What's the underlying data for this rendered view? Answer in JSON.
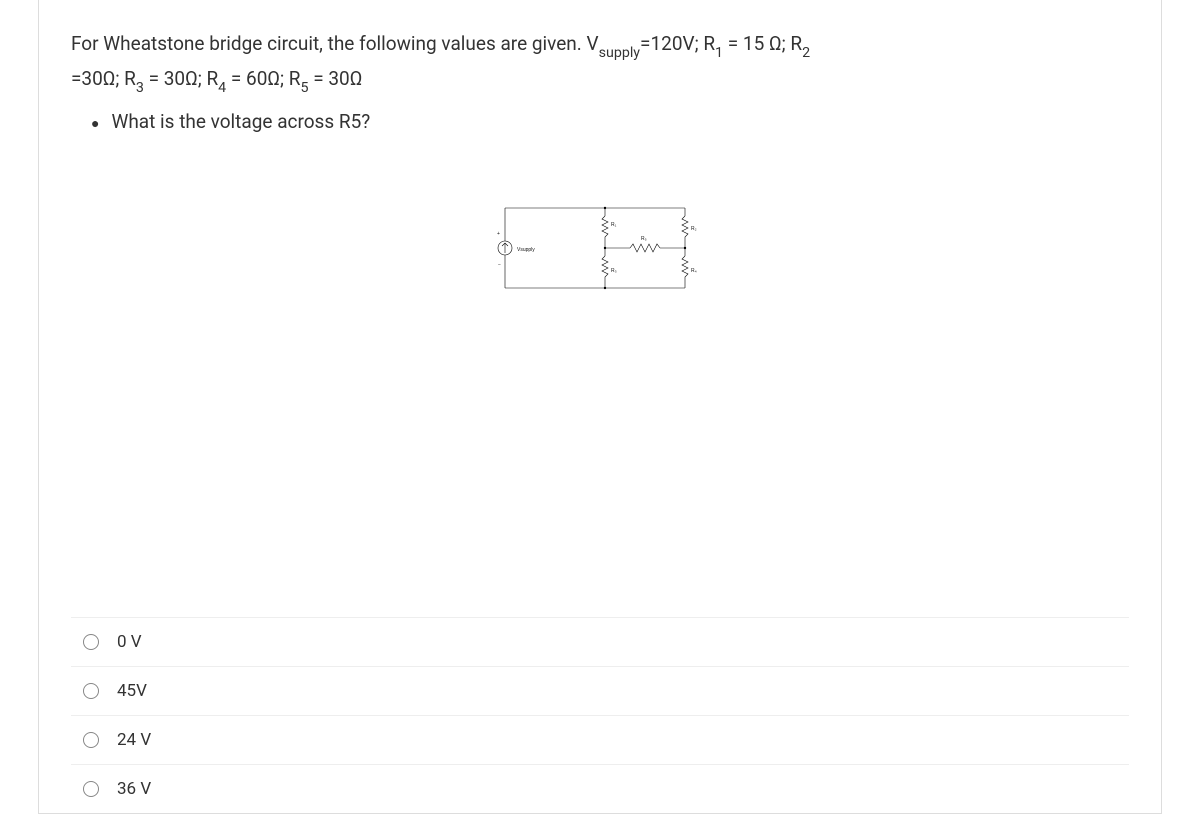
{
  "question": {
    "line1_prefix": "For Wheatstone bridge circuit, the following values are given. V",
    "line1_sub1": "supply",
    "line1_mid1": "=120V;   R",
    "line1_sub2": "1",
    "line1_mid2": " = 15 Ω;   R",
    "line1_sub3": "2",
    "line2_prefix": "=30Ω;  R",
    "line2_sub1": "3",
    "line2_mid1": " = 30Ω; R",
    "line2_sub2": "4",
    "line2_mid2": " = 60Ω; R",
    "line2_sub3": "5",
    "line2_end": " = 30Ω",
    "bullet_prefix": "What is the voltage across R",
    "bullet_sub": "5",
    "bullet_suffix": "?"
  },
  "circuit": {
    "vsupply_label": "Vsupply",
    "r1": "R₁",
    "r2": "R₂",
    "r3": "R₃",
    "r4": "R₄",
    "r5": "R₅"
  },
  "options": [
    {
      "label": "0 V"
    },
    {
      "label": "45V"
    },
    {
      "label": "24 V"
    },
    {
      "label": "36 V"
    }
  ]
}
